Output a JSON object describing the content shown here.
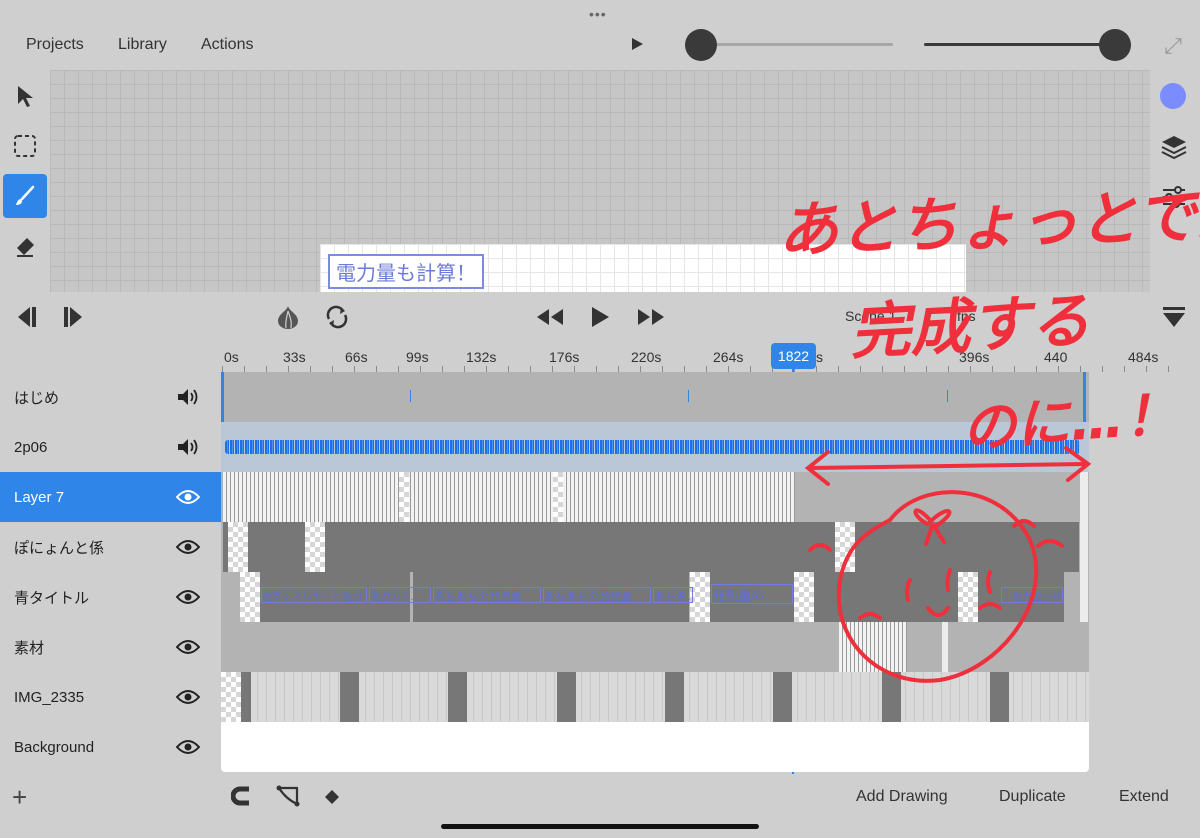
{
  "window": {
    "grip": "•••"
  },
  "menu": {
    "projects": "Projects",
    "library": "Library",
    "actions": "Actions"
  },
  "sliders": {
    "left_level": 0.0,
    "right_level": 1.0
  },
  "canvas": {
    "title_text": "電力量も計算！"
  },
  "tools_left": [
    "select-icon",
    "marquee-icon",
    "brush-icon",
    "eraser-icon"
  ],
  "tools_right": [
    "color-swatch",
    "layers-icon",
    "adjustments-icon"
  ],
  "accent_color": "#2f86e8",
  "swatch_color": "#7b8cff",
  "scene_label": "Scene 1",
  "fps_label": "fps",
  "ruler": {
    "labels": [
      "0s",
      "33s",
      "66s",
      "99s",
      "132s",
      "176s",
      "220s",
      "264s",
      "1822",
      "s",
      "396s",
      "440",
      "484s"
    ],
    "playhead_frame": "1822"
  },
  "layers": [
    {
      "name": "はじめ",
      "icon": "speaker-icon"
    },
    {
      "name": "2p06",
      "icon": "speaker-icon"
    },
    {
      "name": "Layer 7",
      "icon": "eye-icon",
      "active": true
    },
    {
      "name": "ぽにょんと係",
      "icon": "eye-icon"
    },
    {
      "name": "青タイトル",
      "icon": "eye-icon"
    },
    {
      "name": "素材",
      "icon": "eye-icon"
    },
    {
      "name": "IMG_2335",
      "icon": "eye-icon"
    },
    {
      "name": "Background",
      "icon": "eye-icon"
    }
  ],
  "title_clips": [
    "電気エネルギーと電力",
    "電力エネ…",
    "あちあちの発熱量",
    "あちあちの発熱量",
    "あちあ…",
    "発熱量の…",
    "…電力量も計算！"
  ],
  "bottom": {
    "add_drawing": "Add Drawing",
    "duplicate": "Duplicate",
    "extend": "Extend"
  },
  "annotation": {
    "line1": "あとちょっとで…",
    "line2": "完成する",
    "line3": "のに…！",
    "color": "#ef2f3b"
  }
}
